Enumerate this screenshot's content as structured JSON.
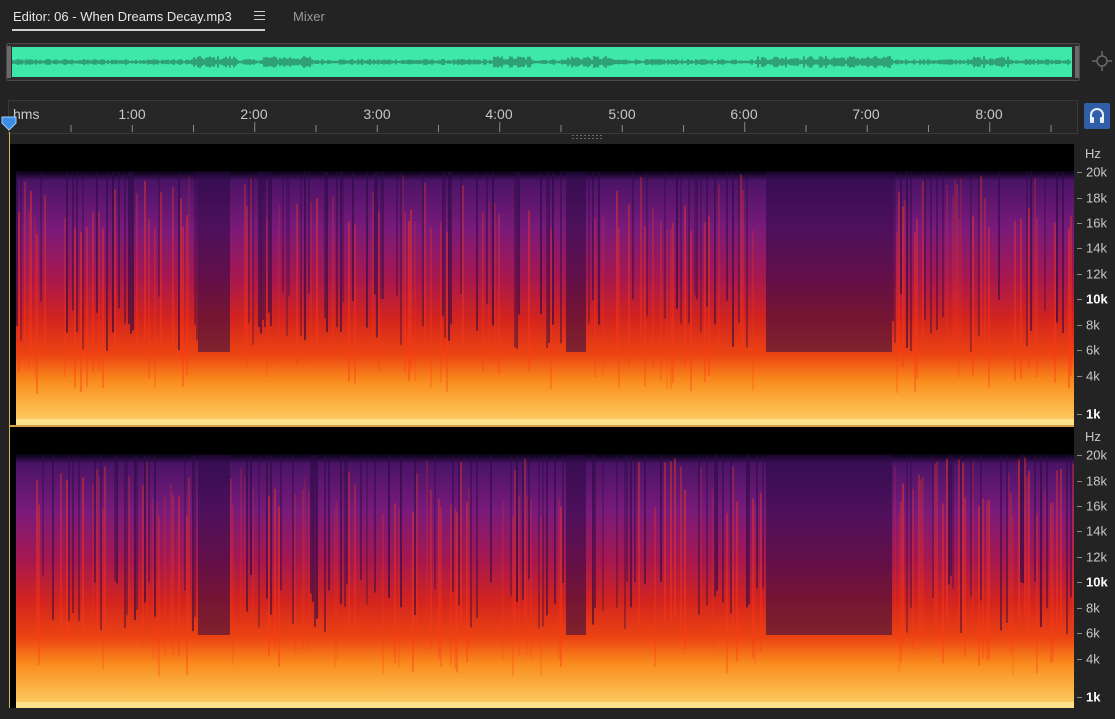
{
  "tabs": {
    "editor_label": "Editor: 06 - When Dreams Decay.mp3",
    "mixer_label": "Mixer"
  },
  "icons": {
    "tab_menu": "hamburger-menu-icon",
    "zoom_navigator": "crosshair-icon",
    "playhead": "playhead-marker-icon",
    "monitor": "headphones-icon"
  },
  "colors": {
    "waveform": "#3ee8a8",
    "monitor_button": "#2f5fa8",
    "playhead": "#d6b15a"
  },
  "ruler": {
    "unit_label": "hms",
    "labels": [
      "1:00",
      "2:00",
      "3:00",
      "4:00",
      "5:00",
      "6:00",
      "7:00",
      "8:00"
    ]
  },
  "frequency_axis": {
    "title": "Hz",
    "ticks": [
      {
        "label": "20k",
        "hz": 20000,
        "major": false
      },
      {
        "label": "18k",
        "hz": 18000,
        "major": false
      },
      {
        "label": "16k",
        "hz": 16000,
        "major": false
      },
      {
        "label": "14k",
        "hz": 14000,
        "major": false
      },
      {
        "label": "12k",
        "hz": 12000,
        "major": false
      },
      {
        "label": "10k",
        "hz": 10000,
        "major": true
      },
      {
        "label": "8k",
        "hz": 8000,
        "major": false
      },
      {
        "label": "6k",
        "hz": 6000,
        "major": false
      },
      {
        "label": "4k",
        "hz": 4000,
        "major": false
      },
      {
        "label": "1k",
        "hz": 1000,
        "major": true
      }
    ]
  }
}
